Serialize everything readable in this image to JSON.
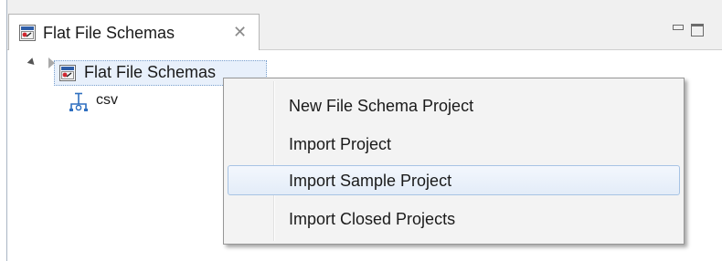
{
  "view": {
    "tab_label": "Flat File Schemas",
    "tab_close_glyph": "✕",
    "tab_icon": "schema-view-icon",
    "toolbar_icons": [
      "minimize-icon",
      "maximize-icon"
    ]
  },
  "tree": {
    "root": {
      "label": "Flat File Schemas",
      "icon": "schema-project-icon",
      "expanded": true
    },
    "children": [
      {
        "label": "csv",
        "icon": "schema-tree-icon",
        "expanded": false
      }
    ]
  },
  "context_menu": {
    "items": [
      {
        "label": "New File Schema Project",
        "highlighted": false
      },
      {
        "label": "Import Project",
        "highlighted": false
      },
      {
        "label": "Import Sample Project",
        "highlighted": true
      },
      {
        "label": "Import Closed Projects",
        "highlighted": false
      }
    ]
  },
  "colors": {
    "selection_bg": "#e8f0fb",
    "highlight_border": "#a7c3e4",
    "menu_bg": "#f3f3f3"
  }
}
